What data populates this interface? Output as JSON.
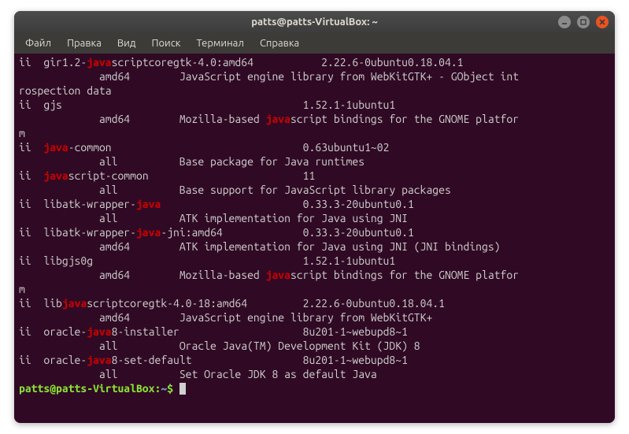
{
  "window": {
    "title": "patts@patts-VirtualBox: ~"
  },
  "menu": {
    "file": "Файл",
    "edit": "Правка",
    "view": "Вид",
    "search": "Поиск",
    "terminal": "Терминал",
    "help": "Справка"
  },
  "highlight": "java",
  "lines": [
    [
      [
        "ii  gir1.2-"
      ],
      [
        "java",
        "hl"
      ],
      [
        "scriptcoregtk-4.0:amd64           2.22.6-0ubuntu0.18.04.1"
      ]
    ],
    [
      [
        "             amd64        JavaScript engine library from WebKitGTK+ - GObject int"
      ]
    ],
    [
      [
        "rospection data"
      ]
    ],
    [
      [
        "ii  gjs                                       1.52.1-1ubuntu1"
      ]
    ],
    [
      [
        "             amd64        Mozilla-based "
      ],
      [
        "java",
        "hl"
      ],
      [
        "script bindings for the GNOME platfor"
      ]
    ],
    [
      [
        "m"
      ]
    ],
    [
      [
        "ii  "
      ],
      [
        "java",
        "hl"
      ],
      [
        "-common                               0.63ubuntu1~02"
      ]
    ],
    [
      [
        "             all          Base package for Java runtimes"
      ]
    ],
    [
      [
        "ii  "
      ],
      [
        "java",
        "hl"
      ],
      [
        "script-common                         11"
      ]
    ],
    [
      [
        "             all          Base support for JavaScript library packages"
      ]
    ],
    [
      [
        "ii  libatk-wrapper-"
      ],
      [
        "java",
        "hl"
      ],
      [
        "                       0.33.3-20ubuntu0.1"
      ]
    ],
    [
      [
        "             all          ATK implementation for Java using JNI"
      ]
    ],
    [
      [
        "ii  libatk-wrapper-"
      ],
      [
        "java",
        "hl"
      ],
      [
        "-jni:amd64             0.33.3-20ubuntu0.1"
      ]
    ],
    [
      [
        "             amd64        ATK implementation for Java using JNI (JNI bindings)"
      ]
    ],
    [
      [
        "ii  libgjs0g                                  1.52.1-1ubuntu1"
      ]
    ],
    [
      [
        "             amd64        Mozilla-based "
      ],
      [
        "java",
        "hl"
      ],
      [
        "script bindings for the GNOME platfor"
      ]
    ],
    [
      [
        "m"
      ]
    ],
    [
      [
        "ii  lib"
      ],
      [
        "java",
        "hl"
      ],
      [
        "scriptcoregtk-4.0-18:amd64         2.22.6-0ubuntu0.18.04.1"
      ]
    ],
    [
      [
        "             amd64        JavaScript engine library from WebKitGTK+"
      ]
    ],
    [
      [
        "ii  oracle-"
      ],
      [
        "java",
        "hl"
      ],
      [
        "8-installer                    8u201-1~webupd8~1"
      ]
    ],
    [
      [
        "             all          Oracle Java(TM) Development Kit (JDK) 8"
      ]
    ],
    [
      [
        "ii  oracle-"
      ],
      [
        "java",
        "hl"
      ],
      [
        "8-set-default                  8u201-1~webupd8~1"
      ]
    ],
    [
      [
        "             all          Set Oracle JDK 8 as default Java"
      ]
    ]
  ],
  "prompt": {
    "userhost": "patts@patts-VirtualBox",
    "colon": ":",
    "path": "~",
    "dollar": "$"
  }
}
